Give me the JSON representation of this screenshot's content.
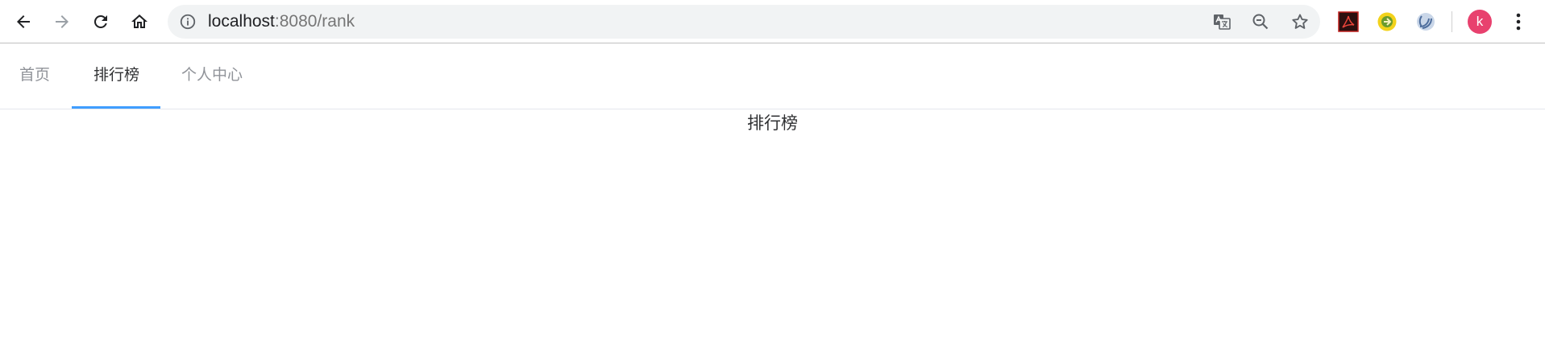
{
  "browser": {
    "url_host": "localhost",
    "url_rest": ":8080/rank",
    "avatar_letter": "k"
  },
  "nav": {
    "tabs": [
      {
        "label": "首页",
        "active": false
      },
      {
        "label": "排行榜",
        "active": true
      },
      {
        "label": "个人中心",
        "active": false
      }
    ]
  },
  "page": {
    "title": "排行榜"
  }
}
